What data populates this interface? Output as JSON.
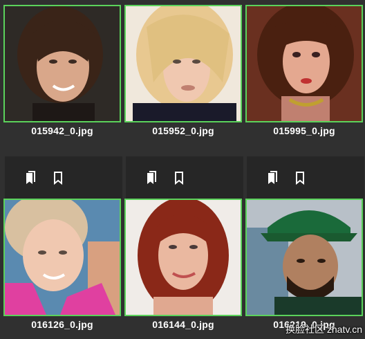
{
  "accent_color": "#5bd35b",
  "row1": [
    {
      "filename": "015942_0.jpg"
    },
    {
      "filename": "015952_0.jpg"
    },
    {
      "filename": "015995_0.jpg"
    }
  ],
  "toolbars": [
    {
      "icon_left": "bookmarks-icon",
      "icon_right": "bookmark-icon"
    },
    {
      "icon_left": "bookmarks-icon",
      "icon_right": "bookmark-icon"
    },
    {
      "icon_left": "bookmarks-icon",
      "icon_right": "bookmark-icon"
    }
  ],
  "row2": [
    {
      "filename": "016126_0.jpg"
    },
    {
      "filename": "016144_0.jpg"
    },
    {
      "filename": "016219_0.jpg"
    }
  ],
  "watermark": "换脸社区 zhatv.cn"
}
